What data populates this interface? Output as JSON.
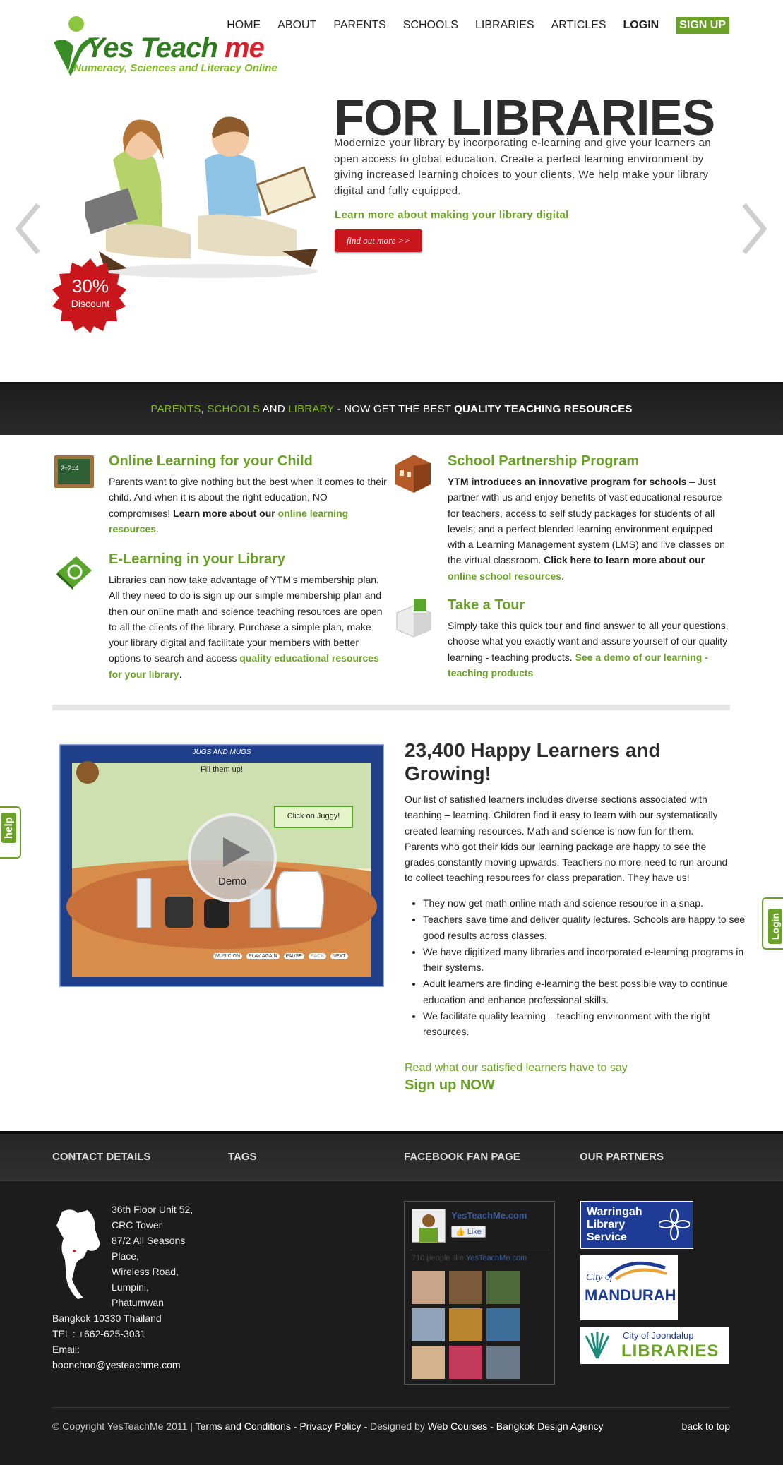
{
  "logo": {
    "yes": "Yes",
    "teach": " Teach",
    "me": " me",
    "tagline": "Numeracy, Sciences and Literacy Online"
  },
  "nav": [
    "HOME",
    "ABOUT",
    "PARENTS",
    "SCHOOLS",
    "LIBRARIES",
    "ARTICLES"
  ],
  "nav_login": "LOGIN",
  "nav_signup": "SIGN UP",
  "hero": {
    "title": "FOR LIBRARIES",
    "text": "Modernize your library by incorporating e-learning and give your learners an open access to global education. Create a perfect learning environment by giving increased learning choices to your clients. We help make your library digital and fully equipped.",
    "link": "Learn more about making your library digital",
    "button": "find out more >>",
    "badge_pct": "30%",
    "badge_label": "Discount"
  },
  "strip": {
    "parents": "PARENTS",
    "comma": ", ",
    "schools": "SCHOOLS",
    "and": " AND ",
    "library": "LIBRARY",
    "rest": " - NOW GET THE BEST ",
    "bold": "QUALITY TEACHING RESOURCES"
  },
  "features": {
    "online": {
      "title": "Online Learning for your Child",
      "text1": "Parents want to give nothing but the best when it comes to their child. And when it is about the right education, NO compromises! ",
      "bold": "Learn more about our ",
      "link": "online learning resources",
      "end": "."
    },
    "elearning": {
      "title": "E-Learning in your Library",
      "text1": "Libraries can now take advantage of YTM's membership plan. All they need to do is sign up our simple membership plan and then our online math and science teaching resources are open to all the clients of the library. Purchase a simple plan, make your library digital and facilitate your members with better options to search and access ",
      "link": "quality educational resources for your library",
      "end": "."
    },
    "school": {
      "title": "School Partnership Program",
      "bold1": "YTM introduces an innovative program for schools",
      "text1": " – Just partner with us and enjoy benefits of vast educational resource for teachers, access to self study packages for students of all levels; and a perfect blended learning environment equipped with a Learning Management system (LMS) and live classes on the virtual classroom. ",
      "bold2": "Click here to learn more about our ",
      "link": "online school resources",
      "end": "."
    },
    "tour": {
      "title": "Take a Tour",
      "text1": "Simply take this quick tour and find answer to all your questions, choose what you exactly want and assure yourself of our quality learning - teaching products. ",
      "link": "See a demo of our learning - teaching products"
    }
  },
  "demo": {
    "title": "JUGS AND MUGS",
    "fill": "Fill them up!",
    "click": "Click on Juggy!",
    "label": "Demo",
    "controls": [
      "MUSIC ON",
      "PLAY AGAIN",
      "PAUSE",
      "BACK",
      "NEXT"
    ]
  },
  "learners": {
    "title": "23,400 Happy Learners and Growing!",
    "text": "Our list of satisfied learners includes diverse sections associated with teaching – learning. Children find it easy to learn with our systematically created learning resources. Math and science is now fun for them. Parents who got their kids our learning package are happy to see the grades constantly moving upwards. Teachers no more need to run around to collect teaching resources for class preparation. They have us!",
    "bullets": [
      "They now get math online math and science resource in a snap.",
      "Teachers save time and deliver quality lectures. Schools are happy to see good results across classes.",
      "We have digitized many libraries and incorporated e-learning programs in their systems.",
      "Adult learners are finding e-learning the best possible way to continue education and enhance professional skills.",
      "We facilitate quality learning – teaching environment with the right resources."
    ],
    "read_link": "Read what our satisfied learners have to say",
    "signup": "Sign up NOW"
  },
  "side_tabs": {
    "help": "help",
    "login": "Login"
  },
  "footer": {
    "headings": [
      "CONTACT DETAILS",
      "TAGS",
      "FACEBOOK FAN PAGE",
      "OUR PARTNERS"
    ],
    "address_indented": [
      "36th Floor Unit 52,",
      "CRC Tower",
      "87/2 All Seasons",
      "Place,",
      "Wireless Road,",
      "Lumpini,",
      "Phatumwan"
    ],
    "address_full": [
      "Bangkok 10330 Thailand",
      "TEL : +662-625-3031",
      "Email:"
    ],
    "email": "boonchoo@yesteachme.com",
    "fb": {
      "name": "YesTeachMe.com",
      "like": "Like",
      "count": "710 people like ",
      "count_name": "YesTeachMe.com"
    },
    "partners": {
      "p1": [
        "Warringah",
        "Library",
        "Service"
      ],
      "p2_top": "City of",
      "p2_name": "MANDURAH",
      "p3_top": "City of Joondalup",
      "p3_name": "LIBRARIES"
    },
    "copyright": "© Copyright YesTeachMe 2011 | ",
    "terms": "Terms and Conditions",
    "sep1": " - ",
    "privacy": "Privacy Policy",
    "designed": " - Designed by ",
    "web": "Web Courses",
    "sep2": " - ",
    "agency": "Bangkok Design Agency",
    "back_top": "back to top"
  }
}
